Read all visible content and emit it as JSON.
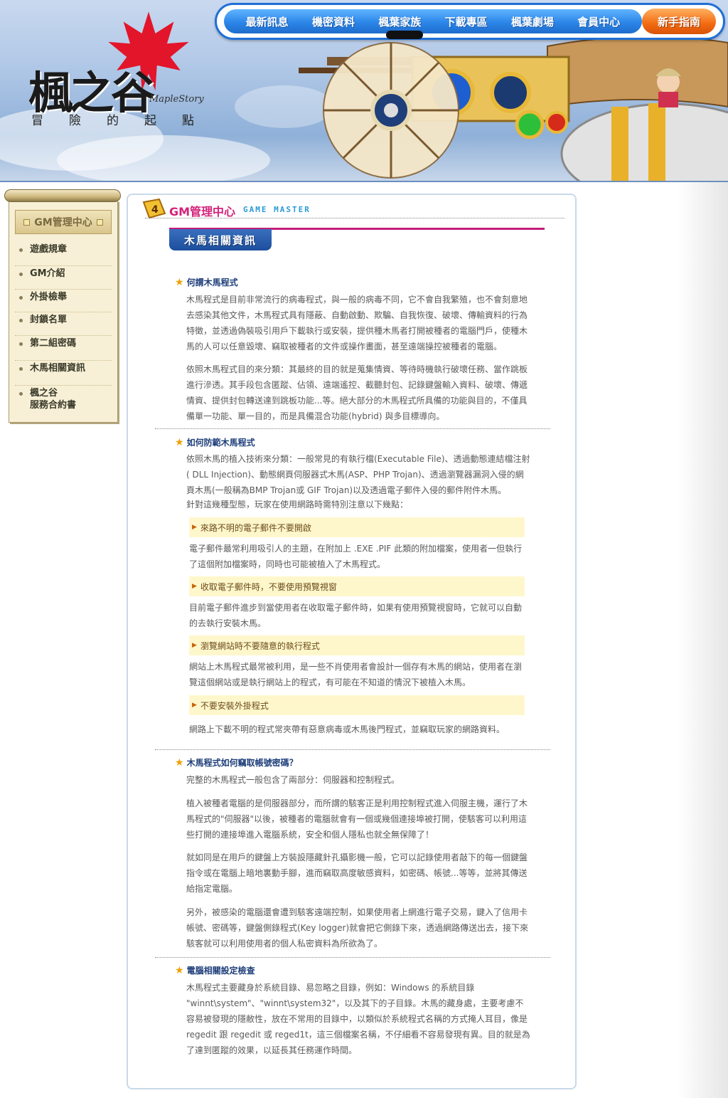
{
  "header": {
    "logo_text": "楓之谷",
    "logo_sub": "MapleStory",
    "slogan": [
      "冒",
      "險",
      "的",
      "起",
      "點"
    ]
  },
  "nav": {
    "items": [
      "最新訊息",
      "機密資料",
      "楓葉家族",
      "下載專區",
      "楓葉劇場",
      "會員中心"
    ],
    "newbie": "新手指南"
  },
  "menu": {
    "title": "GM管理中心",
    "items": [
      "遊戲規章",
      "GM介紹",
      "外掛檢舉",
      "封鎖名單",
      "第二組密碼",
      "木馬相關資訊",
      "楓之谷\n服務合約書"
    ]
  },
  "content": {
    "gm_title": "GM管理中心",
    "gm_sub": "GAME MASTER",
    "tab": "木馬相關資訊",
    "sections": [
      {
        "title": "何謂木馬程式",
        "paras": [
          "木馬程式是目前非常流行的病毒程式，與一般的病毒不同，它不會自我繁殖，也不會刻意地去感染其他文件，木馬程式具有隱蔽、自動啟動、欺騙、自我恢復、破壞、傳輸資料的行為特徵，並透過偽裝吸引用戶下載執行或安裝，提供種木馬者打開被種者的電腦門戶，使種木馬的人可以任意毀壞、竊取被種者的文件或操作畫面，甚至遠端操控被種者的電腦。",
          "依照木馬程式目的來分類：其最終的目的就是蒐集情資、等待時機執行破壞任務、當作跳板進行滲透。其手段包含匿蹤、佔領、遠端遙控、截聽封包、記錄鍵盤輸入資料、破壞、傳遞情資、提供封包轉送達到跳板功能...等。絕大部分的木馬程式所具備的功能與目的，不僅具備單一功能、單一目的，而是具備混合功能(hybrid) 與多目標導向。"
        ]
      },
      {
        "title": "如何防範木馬程式",
        "intro": "依照木馬的植入技術來分類：一般常見的有執行檔(Executable File)、透過動態連結檔注射( DLL Injection)、動態網頁伺服器式木馬(ASP、PHP Trojan)、透過瀏覽器漏洞入侵的網頁木馬(一般稱為BMP Trojan或 GIF Trojan)以及透過電子郵件入侵的郵件附件木馬。",
        "intro2": "針對這幾種型態，玩家在使用網路時需特別注意以下幾點：",
        "tips": [
          {
            "label": "來路不明的電子郵件不要開啟",
            "text": "電子郵件最常利用吸引人的主題，在附加上 .EXE .PIF 此類的附加檔案，使用者一但執行了這個附加檔案時，同時也可能被植入了木馬程式。"
          },
          {
            "label": "收取電子郵件時，不要使用預覽視窗",
            "text": "目前電子郵件進步到當使用者在收取電子郵件時，如果有使用預覽視窗時，它就可以自動的去執行安裝木馬。"
          },
          {
            "label": "瀏覽網站時不要隨意的執行程式",
            "text": "網站上木馬程式最常被利用，是一些不肖使用者會設計一個存有木馬的網站，使用者在瀏覽這個網站或是執行網站上的程式，有可能在不知道的情況下被植入木馬。"
          },
          {
            "label": "不要安裝外掛程式",
            "text": "網路上下載不明的程式常夾帶有惡意病毒或木馬後門程式，並竊取玩家的網路資料。"
          }
        ]
      },
      {
        "title": "木馬程式如何竊取帳號密碼？",
        "paras": [
          "完整的木馬程式一般包含了兩部分：伺服器和控制程式。",
          "植入被種者電腦的是伺服器部分，而所謂的駭客正是利用控制程式進入伺服主機，運行了木馬程式的\"伺服器\"以後，被種者的電腦就會有一個或幾個連接埠被打開，使駭客可以利用這些打開的連接埠進入電腦系統，安全和個人隱私也就全無保障了！",
          "就如同是在用戶的鍵盤上方裝設隱藏針孔攝影機一般，它可以記錄使用者敲下的每一個鍵盤指令或在電腦上暗地裏動手腳，進而竊取高度敏感資料，如密碼、帳號...等等，並將其傳送給指定電腦。",
          "另外，被感染的電腦還會遭到駭客遠端控制，如果使用者上網進行電子交易，鍵入了信用卡帳號、密碼等，鍵盤側錄程式(Key logger)就會把它側錄下來，透過網路傳送出去，接下來駭客就可以利用使用者的個人私密資料為所欲為了。"
        ]
      },
      {
        "title": "電腦相關設定檢查",
        "paras": [
          "木馬程式主要藏身於系統目錄、易忽略之目錄，例如：Windows 的系統目錄 \"winnt\\system\"、\"winnt\\system32\"，以及其下的子目錄。木馬的藏身處，主要考慮不容易被發現的隱敝性，放在不常用的目錄中，以類似於系統程式名稱的方式掩人耳目，像是 regedit 跟 regedit 或 reged1t，這三個檔案名稱，不仔細看不容易發現有異。目的就是為了達到匿蹤的效果，以延長其任務運作時間。"
        ]
      }
    ]
  }
}
